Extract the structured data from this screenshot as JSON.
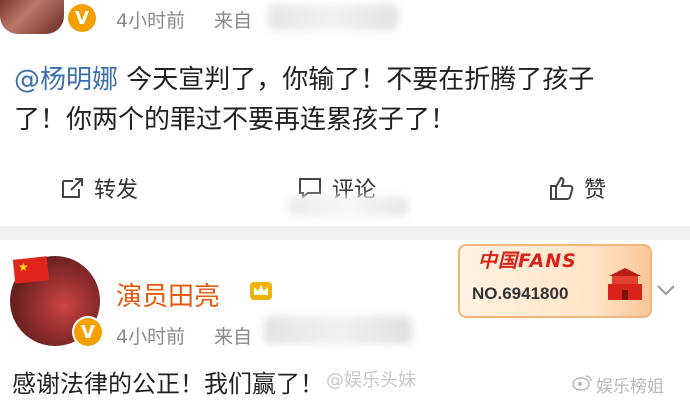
{
  "post1": {
    "time": "4小时前",
    "source_label": "来自",
    "verified_badge": "V",
    "mention": "@杨明娜",
    "text_line1": " 今天宣判了，你输了！不要在折腾了孩子",
    "text_line2": "了！你两个的罪过不要再连累孩子了！",
    "actions": {
      "forward_label": "转发",
      "comment_label": "评论",
      "like_label": "赞",
      "forward_icon": "share-icon",
      "comment_icon": "comment-icon",
      "like_icon": "thumbs-up-icon"
    }
  },
  "post2": {
    "author": "演员田亮",
    "time": "4小时前",
    "source_label": "来自",
    "verified_badge": "V",
    "badge_icon": "crown-icon",
    "fans_badge": {
      "title": "中国FANS",
      "number": "NO.6941800"
    },
    "text": "感谢法律的公正！我们赢了！",
    "colors": {
      "author": "#e8590c",
      "mention": "#3b6fb0",
      "verified": "#f3a000"
    }
  },
  "watermarks": {
    "left": "@娱乐头妹",
    "right": "娱乐榜姐"
  }
}
